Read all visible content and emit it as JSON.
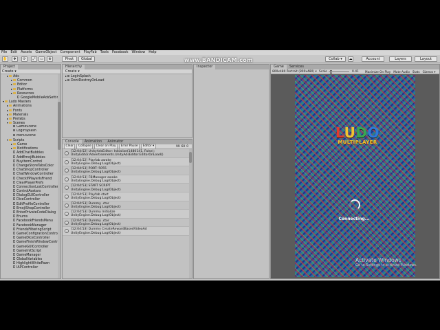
{
  "watermark": "www.BANDICAM.com",
  "menu": [
    "File",
    "Edit",
    "Assets",
    "GameObject",
    "Component",
    "PlayFab",
    "Tools",
    "Facebook",
    "Window",
    "Help"
  ],
  "toolbar": {
    "pivot": "Pivot",
    "global": "Global",
    "collab": "Collab ▾",
    "account": "Account",
    "layers": "Layers",
    "layout": "Layout"
  },
  "project": {
    "tab": "Project",
    "create": "Create ▾",
    "items": [
      {
        "label": "Ads",
        "depth": 1,
        "arrow": "▸",
        "type": "folder"
      },
      {
        "label": "Common",
        "depth": 2,
        "arrow": "▸",
        "type": "folder"
      },
      {
        "label": "Editor",
        "depth": 2,
        "arrow": "▸",
        "type": "folder"
      },
      {
        "label": "Platforms",
        "depth": 2,
        "arrow": "▸",
        "type": "folder"
      },
      {
        "label": "Resources",
        "depth": 2,
        "arrow": "▸",
        "type": "folder"
      },
      {
        "label": "GoogleMobileAdsSettings",
        "depth": 3,
        "arrow": "",
        "type": "file"
      },
      {
        "label": "Ludo Masters",
        "depth": 0,
        "arrow": "▾",
        "type": "folder"
      },
      {
        "label": "Animations",
        "depth": 1,
        "arrow": "▸",
        "type": "folder"
      },
      {
        "label": "Fonts",
        "depth": 1,
        "arrow": "▸",
        "type": "folder"
      },
      {
        "label": "Materials",
        "depth": 1,
        "arrow": "▸",
        "type": "folder"
      },
      {
        "label": "Prefabs",
        "depth": 1,
        "arrow": "▸",
        "type": "folder"
      },
      {
        "label": "Scenes",
        "depth": 1,
        "arrow": "▾",
        "type": "folder"
      },
      {
        "label": "GameScene",
        "depth": 2,
        "arrow": "",
        "type": "scene"
      },
      {
        "label": "LoginSplash",
        "depth": 2,
        "arrow": "",
        "type": "scene"
      },
      {
        "label": "MenuScene",
        "depth": 2,
        "arrow": "",
        "type": "scene"
      },
      {
        "label": "Scripts",
        "depth": 1,
        "arrow": "▾",
        "type": "folder"
      },
      {
        "label": "Game",
        "depth": 2,
        "arrow": "▸",
        "type": "folder"
      },
      {
        "label": "Notifications",
        "depth": 2,
        "arrow": "▸",
        "type": "folder"
      },
      {
        "label": "AddChatBubbles",
        "depth": 2,
        "arrow": "",
        "type": "file"
      },
      {
        "label": "AddEmojiBubbles",
        "depth": 2,
        "arrow": "",
        "type": "file"
      },
      {
        "label": "BuyItemControl",
        "depth": 2,
        "arrow": "",
        "type": "file"
      },
      {
        "label": "ChangeStoreTabsColor",
        "depth": 2,
        "arrow": "",
        "type": "file"
      },
      {
        "label": "ChatShopController",
        "depth": 2,
        "arrow": "",
        "type": "file"
      },
      {
        "label": "ChatWindowController",
        "depth": 2,
        "arrow": "",
        "type": "file"
      },
      {
        "label": "CheckIfPlayerIsFriend",
        "depth": 2,
        "arrow": "",
        "type": "file"
      },
      {
        "label": "ClearPlayerPrefs",
        "depth": 2,
        "arrow": "",
        "type": "file"
      },
      {
        "label": "ConnectionLostController",
        "depth": 2,
        "arrow": "",
        "type": "file"
      },
      {
        "label": "ControlAvatars",
        "depth": 2,
        "arrow": "",
        "type": "file"
      },
      {
        "label": "DialogGUIController",
        "depth": 2,
        "arrow": "",
        "type": "file"
      },
      {
        "label": "DiceController",
        "depth": 2,
        "arrow": "",
        "type": "file"
      },
      {
        "label": "EditProfileController",
        "depth": 2,
        "arrow": "",
        "type": "file"
      },
      {
        "label": "EmojiShopController",
        "depth": 2,
        "arrow": "",
        "type": "file"
      },
      {
        "label": "EnterPrivateCodeDialog",
        "depth": 2,
        "arrow": "",
        "type": "file"
      },
      {
        "label": "Enums",
        "depth": 2,
        "arrow": "",
        "type": "file"
      },
      {
        "label": "FacebookFriendsMenu",
        "depth": 2,
        "arrow": "",
        "type": "file"
      },
      {
        "label": "FacebookManager",
        "depth": 2,
        "arrow": "",
        "type": "file"
      },
      {
        "label": "FriendsFilteringScript",
        "depth": 2,
        "arrow": "",
        "type": "file"
      },
      {
        "label": "GameConfigrationController",
        "depth": 2,
        "arrow": "",
        "type": "file"
      },
      {
        "label": "GameDiceController",
        "depth": 2,
        "arrow": "",
        "type": "file"
      },
      {
        "label": "GameFinishWindowController",
        "depth": 2,
        "arrow": "",
        "type": "file"
      },
      {
        "label": "GameGUIController",
        "depth": 2,
        "arrow": "",
        "type": "file"
      },
      {
        "label": "GameInitScript",
        "depth": 2,
        "arrow": "",
        "type": "file"
      },
      {
        "label": "GameManager",
        "depth": 2,
        "arrow": "",
        "type": "file"
      },
      {
        "label": "GlobalVariables",
        "depth": 2,
        "arrow": "",
        "type": "file"
      },
      {
        "label": "HighlightWhitePawn",
        "depth": 2,
        "arrow": "",
        "type": "file"
      },
      {
        "label": "IAPController",
        "depth": 2,
        "arrow": "",
        "type": "file"
      }
    ]
  },
  "hierarchy": {
    "tab": "Hierarchy",
    "create": "Create ▾",
    "items": [
      "LoginSplash",
      "DontDestroyOnLoad"
    ]
  },
  "inspector": {
    "tab": "Inspector"
  },
  "console": {
    "tabs": [
      "Console",
      "Animation",
      "Animator"
    ],
    "buttons": [
      "Clear",
      "Collapse",
      "Clear on Play",
      "Error Pause",
      "Editor ▾"
    ],
    "counts": {
      "info": "99",
      "warn": "60",
      "error": "0"
    },
    "logs": [
      {
        "line1": "[12:04:52] UnityAdsEditor: Initialize(1480141, False);",
        "line2": "UnityEditor.Advertisements.UnityAdsEditor:EditorOnLoad()"
      },
      {
        "line1": "[12:04:52] Playfab awake",
        "line2": "UnityEngine.Debug:Log(Object)"
      },
      {
        "line1": "[12:04:53] PORT: 5055",
        "line2": "UnityEngine.Debug:Log(Object)"
      },
      {
        "line1": "[12:04:53] FBManager awake",
        "line2": "UnityEngine.Debug:Log(Object)"
      },
      {
        "line1": "[12:04:53] START SCRIPT",
        "line2": "UnityEngine.Debug:Log(Object)"
      },
      {
        "line1": "[12:04:53] Playfab start",
        "line2": "UnityEngine.Debug:Log(Object)"
      },
      {
        "line1": "[12:04:53] Dummy .ctor",
        "line2": "UnityEngine.Debug:Log(Object)"
      },
      {
        "line1": "[12:04:53] Dummy Initialize",
        "line2": "UnityEngine.Debug:Log(Object)"
      },
      {
        "line1": "[12:04:53] Dummy .ctor",
        "line2": "UnityEngine.Debug:Log(Object)"
      },
      {
        "line1": "[12:04:53] Dummy CreateRewardBasedVideoAd",
        "line2": "UnityEngine.Debug:Log(Object)"
      }
    ]
  },
  "game": {
    "tabs": [
      "Game",
      "Services"
    ],
    "resolution": "800x480 Portrait (800x480) ▾",
    "scale_label": "Scale",
    "scale_value": "0.41",
    "options": [
      "Maximize On Play",
      "Mute Audio",
      "Stats",
      "Gizmos ▾"
    ],
    "logo_letters": [
      {
        "ch": "L",
        "color": "#e23b2e"
      },
      {
        "ch": "U",
        "color": "#f2c230"
      },
      {
        "ch": "D",
        "color": "#3aa652"
      },
      {
        "ch": "O",
        "color": "#2f79d8"
      }
    ],
    "logo_sub": "MULTIPLAYER",
    "status": "Connecting..."
  },
  "activate": {
    "title": "Activate Windows",
    "subtitle": "Go to Settings to activate Windows."
  }
}
